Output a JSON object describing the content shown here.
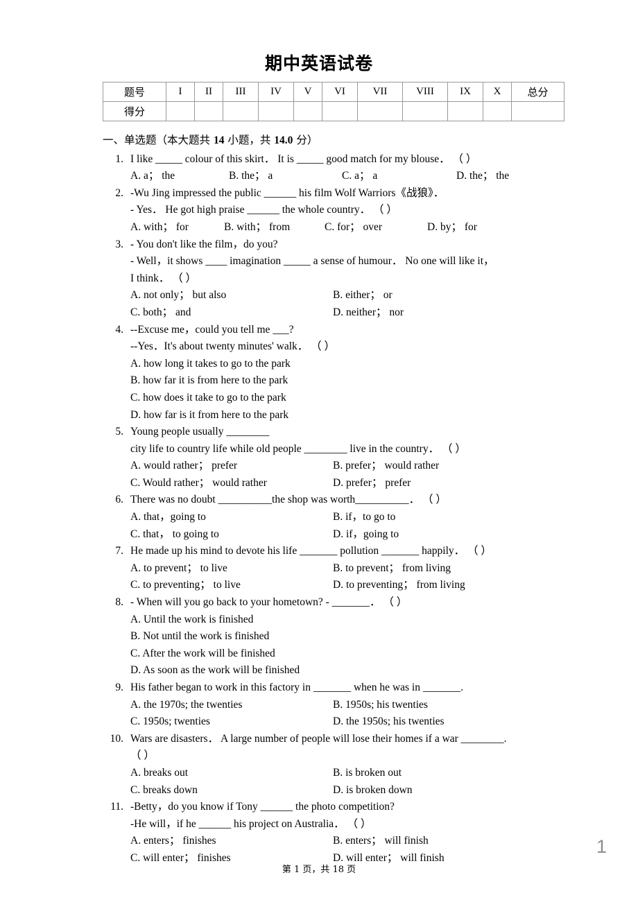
{
  "document": {
    "title": "期中英语试卷",
    "footer": "第 1 页，共 18 页",
    "page_number": "1"
  },
  "score_table": {
    "row_labels": [
      "题号",
      "得分"
    ],
    "columns": [
      "I",
      "II",
      "III",
      "IV",
      "V",
      "VI",
      "VII",
      "VIII",
      "IX",
      "X"
    ],
    "total_label": "总分",
    "scores": [
      "",
      "",
      "",
      "",
      "",
      "",
      "",
      "",
      "",
      "",
      ""
    ]
  },
  "sections": [
    {
      "heading_prefix": "一、单选题（本大题共 ",
      "heading_count": "14",
      "heading_mid": " 小题，共 ",
      "heading_points": "14.0",
      "heading_suffix": " 分）"
    }
  ],
  "questions": [
    {
      "number": "1.",
      "stem_lines": [
        "I like _____ colour of this skirt． It is _____ good match for my blouse． （     ）"
      ],
      "layout": "cols4",
      "options": [
        "A. a；  the",
        "B. the；  a",
        "C. a；  a",
        "D. the；  the"
      ]
    },
    {
      "number": "2.",
      "stem_lines": [
        "-Wu Jing impressed the public ______ his film Wolf Warriors《战狼》．",
        "- Yes． He got high praise ______ the whole country． （     ）"
      ],
      "layout": "cols4b",
      "options": [
        "A. with；  for",
        "B. with；  from",
        "C. for；  over",
        "D. by；  for"
      ]
    },
    {
      "number": "3.",
      "stem_lines": [
        "- You don't like the film，do you?",
        "- Well，it shows ____ imagination _____ a sense of humour． No one will like it，",
        "I think． （     ）"
      ],
      "layout": "cols2",
      "options": [
        "A. not only；  but also",
        "B. either；  or",
        "C. both；  and",
        "D. neither；  nor"
      ]
    },
    {
      "number": "4.",
      "stem_lines": [
        "--Excuse me，could you tell me ___?",
        "--Yes．It's about twenty minutes' walk． （     ）"
      ],
      "layout": "cols1",
      "options": [
        "A. how long it takes to go to the park",
        "B. how far it is from here to the park",
        "C. how does it take to go to the park",
        "D. how far is it from here to the park"
      ]
    },
    {
      "number": "5.",
      "stem_lines": [
        "Young people usually ________",
        "city life to country life while old people ________ live in the country． （     ）"
      ],
      "layout": "cols2",
      "options": [
        "A. would rather；  prefer",
        "B. prefer；  would rather",
        "C. Would rather；  would rather",
        "D. prefer；  prefer"
      ]
    },
    {
      "number": "6.",
      "stem_lines": [
        "There was no doubt __________the shop was worth__________． （     ）"
      ],
      "layout": "cols2",
      "options": [
        "A. that，going to",
        "B. if，to go to",
        "C. that，  to going to",
        "D. if，going to"
      ]
    },
    {
      "number": "7.",
      "stem_lines": [
        "He made up his mind to devote his life _______ pollution _______ happily． （     ）"
      ],
      "layout": "cols2",
      "options": [
        "A. to prevent；  to live",
        "B. to prevent；  from living",
        "C. to preventing；  to live",
        "D. to preventing；  from living"
      ]
    },
    {
      "number": "8.",
      "stem_lines": [
        "- When will you go back to your hometown? - _______． （     ）"
      ],
      "layout": "cols1",
      "options": [
        "A. Until the work is finished",
        "B. Not until the work is finished",
        "C. After the work will be finished",
        "D. As soon as the work will be finished"
      ]
    },
    {
      "number": "9.",
      "stem_lines": [
        "His father began to work in this factory in _______ when he was in _______."
      ],
      "layout": "cols2",
      "options": [
        "A. the 1970s; the twenties",
        "B. 1950s; his twenties",
        "C. 1950s; twenties",
        "D. the 1950s; his twenties"
      ]
    },
    {
      "number": "10.",
      "stem_lines": [
        "Wars are disasters． A large number of people will lose their homes if a war ________.",
        "（     ）"
      ],
      "layout": "cols2",
      "options": [
        "A. breaks out",
        "B. is broken out",
        "C. breaks down",
        "D. is broken down"
      ]
    },
    {
      "number": "11.",
      "stem_lines": [
        "-Betty，do you know if Tony ______ the photo competition?",
        "-He will，if he ______ his project on Australia． （     ）"
      ],
      "layout": "cols2",
      "options": [
        "A. enters；  finishes",
        "B. enters；  will finish",
        "C. will enter；  finishes",
        "D. will enter；  will finish"
      ]
    }
  ]
}
